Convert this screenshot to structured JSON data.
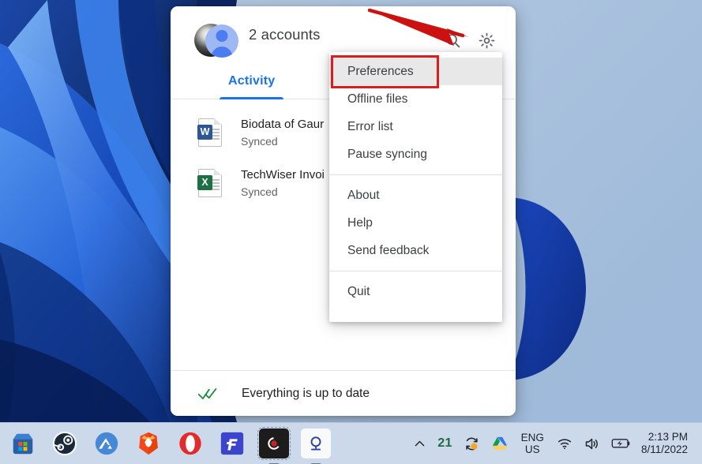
{
  "desktop": {
    "wallpaper_name": "windows-11-blue-bloom-wallpaper",
    "wallpaper_colors": {
      "base": "#a9c2dc",
      "deep_blue": "#0a2a7a",
      "mid_blue": "#1e55c9",
      "light_blue": "#5b9bf0",
      "dark_navy": "#071d4f"
    }
  },
  "drive_panel": {
    "accounts_label": "2 accounts",
    "avatar_name": "user-avatars",
    "search_icon": "search-icon",
    "settings_icon": "gear-icon",
    "tabs": [
      {
        "label": "Activity",
        "active": true
      }
    ],
    "files": [
      {
        "icon": "word-document-icon",
        "badge": "W",
        "name": "Biodata of Gaur",
        "status": "Synced"
      },
      {
        "icon": "excel-spreadsheet-icon",
        "badge": "X",
        "name": "TechWiser Invoi",
        "status": "Synced"
      }
    ],
    "footer": {
      "icon": "double-check-icon",
      "status": "Everything is up to date",
      "status_color": "#1e8e3e"
    }
  },
  "context_menu": {
    "groups": [
      {
        "items": [
          {
            "label": "Preferences",
            "highlighted": true
          },
          {
            "label": "Offline files",
            "highlighted": false
          },
          {
            "label": "Error list",
            "highlighted": false
          },
          {
            "label": "Pause syncing",
            "highlighted": false
          }
        ]
      },
      {
        "items": [
          {
            "label": "About",
            "highlighted": false
          },
          {
            "label": "Help",
            "highlighted": false
          },
          {
            "label": "Send feedback",
            "highlighted": false
          }
        ]
      },
      {
        "items": [
          {
            "label": "Quit",
            "highlighted": false
          }
        ]
      }
    ]
  },
  "annotations": {
    "highlight_color": "#e01b1b",
    "arrow_color": "#cc1111",
    "highlight_target": "Preferences",
    "arrow_target": "gear-icon"
  },
  "taskbar": {
    "apps": [
      {
        "name": "microsoft-store-icon",
        "running": false
      },
      {
        "name": "steam-icon",
        "running": false
      },
      {
        "name": "nordvpn-icon",
        "running": false
      },
      {
        "name": "brave-browser-icon",
        "running": false
      },
      {
        "name": "opera-browser-icon",
        "running": false
      },
      {
        "name": "freedom-app-icon",
        "running": false
      },
      {
        "name": "dark-app-icon",
        "running": true
      },
      {
        "name": "light-app-icon",
        "running": true
      }
    ],
    "tray": {
      "overflow_icon": "chevron-up-icon",
      "count_badge": "21",
      "sync_icon": "sync-refresh-icon",
      "drive_icon": "google-drive-icon",
      "language_line1": "ENG",
      "language_line2": "US",
      "wifi_icon": "wifi-icon",
      "volume_icon": "speaker-icon",
      "battery_icon": "battery-charging-icon",
      "time": "2:13 PM",
      "date": "8/11/2022"
    }
  }
}
